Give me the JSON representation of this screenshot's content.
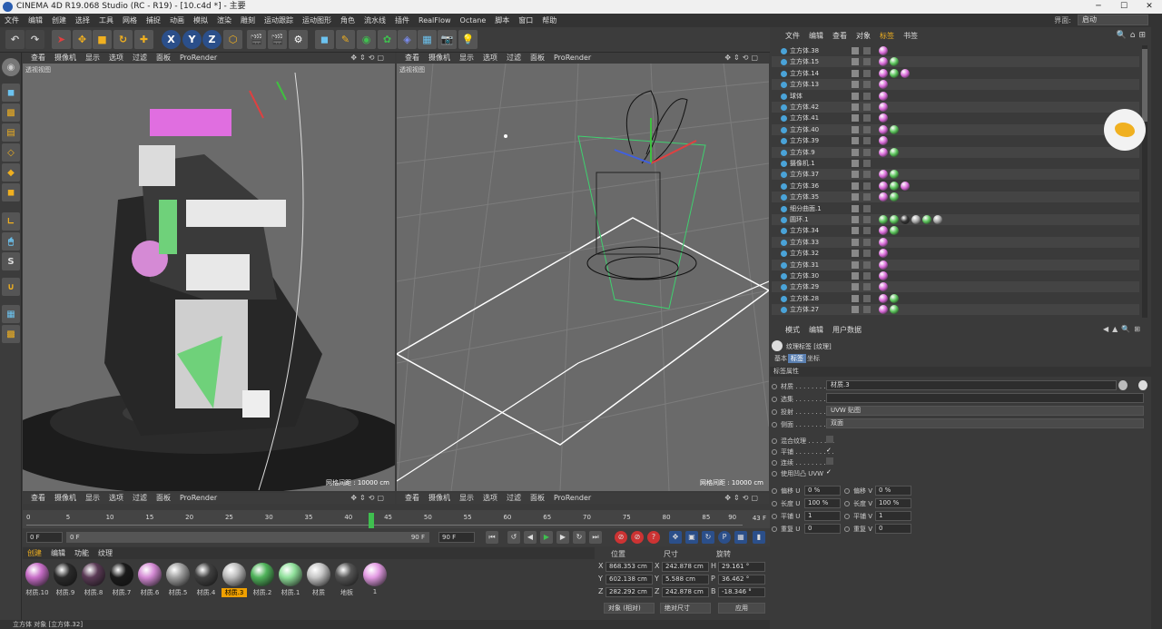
{
  "window": {
    "title": "CINEMA 4D R19.068 Studio (RC - R19) - [10.c4d *] - 主要"
  },
  "menu": [
    "文件",
    "编辑",
    "创建",
    "选择",
    "工具",
    "网格",
    "捕捉",
    "动画",
    "模拟",
    "渲染",
    "雕刻",
    "运动跟踪",
    "运动图形",
    "角色",
    "流水线",
    "插件",
    "RealFlow",
    "Octane",
    "脚本",
    "窗口",
    "帮助"
  ],
  "interface_label": "界面:",
  "interface_value": "启动",
  "toolbar": {
    "x": "X",
    "y": "Y",
    "z": "Z"
  },
  "viewport_menu": [
    "查看",
    "摄像机",
    "显示",
    "选项",
    "过滤",
    "面板",
    "ProRender"
  ],
  "viewport_label": "透视视图",
  "grid_label": "网格间距 : 10000 cm",
  "timeline": {
    "ticks": [
      "0",
      "5",
      "10",
      "15",
      "20",
      "25",
      "30",
      "35",
      "40",
      "45",
      "50",
      "55",
      "60",
      "65",
      "70",
      "75",
      "80",
      "85",
      "90"
    ],
    "current_frame": "43",
    "current_frame_label": "43 F",
    "playhead_fraction": 0.478
  },
  "transport": {
    "start": "0 F",
    "range_start": "0 F",
    "range_end": "90 F",
    "end": "90 F"
  },
  "materials": {
    "tabs": [
      "创建",
      "编辑",
      "功能",
      "纹理"
    ],
    "items": [
      {
        "name": "材质.10",
        "color": "#c86ec8"
      },
      {
        "name": "材质.9",
        "color": "#2a2a2a"
      },
      {
        "name": "材质.8",
        "color": "#5a3a55"
      },
      {
        "name": "材质.7",
        "color": "#1a1a1a"
      },
      {
        "name": "材质.6",
        "color": "#d48ad4"
      },
      {
        "name": "材质.5",
        "color": "#a0a0a0"
      },
      {
        "name": "材质.4",
        "color": "#404040"
      },
      {
        "name": "材质.3",
        "color": "#bdbdbd",
        "selected": true
      },
      {
        "name": "材质.2",
        "color": "#4fb35a"
      },
      {
        "name": "材质.1",
        "color": "#8fe09a"
      },
      {
        "name": "材质",
        "color": "#c6c6c6"
      },
      {
        "name": "地板",
        "color": "#555555"
      },
      {
        "name": "1",
        "color": "#e39be3"
      }
    ]
  },
  "coords": {
    "headers": [
      "位置",
      "尺寸",
      "旋转"
    ],
    "rows": [
      {
        "axis1": "X",
        "pos": "868.353 cm",
        "axis2": "X",
        "size": "242.878 cm",
        "axis3": "H",
        "rot": "29.161 °"
      },
      {
        "axis1": "Y",
        "pos": "602.138 cm",
        "axis2": "Y",
        "size": "5.588 cm",
        "axis3": "P",
        "rot": "36.462 °"
      },
      {
        "axis1": "Z",
        "pos": "282.292 cm",
        "axis2": "Z",
        "size": "242.878 cm",
        "axis3": "B",
        "rot": "-18.346 °"
      }
    ],
    "mode1": "对象 (相对)",
    "mode2": "绝对尺寸",
    "apply": "应用"
  },
  "status": "立方体 对象 [立方体.32]",
  "object_manager": {
    "menu": [
      "文件",
      "编辑",
      "查看",
      "对象",
      "标签",
      "书签"
    ],
    "objects": [
      {
        "name": "立方体.38",
        "tags": [
          "#d86ad8"
        ]
      },
      {
        "name": "立方体.15",
        "tags": [
          "#d86ad8",
          "#5ac35a"
        ]
      },
      {
        "name": "立方体.14",
        "tags": [
          "#d86ad8",
          "#5ac35a",
          "#d86ad8"
        ]
      },
      {
        "name": "立方体.13",
        "tags": [
          "#d86ad8"
        ]
      },
      {
        "name": "球体",
        "tags": [
          "#d86ad8"
        ]
      },
      {
        "name": "立方体.42",
        "tags": [
          "#d86ad8"
        ]
      },
      {
        "name": "立方体.41",
        "tags": [
          "#d86ad8"
        ]
      },
      {
        "name": "立方体.40",
        "tags": [
          "#d86ad8",
          "#5ac35a"
        ]
      },
      {
        "name": "立方体.39",
        "tags": [
          "#d86ad8"
        ]
      },
      {
        "name": "立方体.9",
        "tags": [
          "#d86ad8",
          "#5ac35a"
        ]
      },
      {
        "name": "摄像机.1",
        "tags": []
      },
      {
        "name": "立方体.37",
        "tags": [
          "#d86ad8",
          "#5ac35a"
        ]
      },
      {
        "name": "立方体.36",
        "tags": [
          "#d86ad8",
          "#5ac35a",
          "#d86ad8"
        ]
      },
      {
        "name": "立方体.35",
        "tags": [
          "#d86ad8",
          "#5ac35a"
        ]
      },
      {
        "name": "细分曲面.1",
        "tags": []
      },
      {
        "name": "圆环.1",
        "tags": [
          "#5ac35a",
          "#5ac35a",
          "#333333",
          "#aaaaaa",
          "#5ac35a",
          "#aaaaaa"
        ]
      },
      {
        "name": "立方体.34",
        "tags": [
          "#d86ad8",
          "#5ac35a"
        ]
      },
      {
        "name": "立方体.33",
        "tags": [
          "#d86ad8"
        ]
      },
      {
        "name": "立方体.32",
        "tags": [
          "#d86ad8"
        ]
      },
      {
        "name": "立方体.31",
        "tags": [
          "#d86ad8"
        ]
      },
      {
        "name": "立方体.30",
        "tags": [
          "#d86ad8"
        ]
      },
      {
        "name": "立方体.29",
        "tags": [
          "#d86ad8"
        ]
      },
      {
        "name": "立方体.28",
        "tags": [
          "#d86ad8",
          "#5ac35a"
        ]
      },
      {
        "name": "立方体.27",
        "tags": [
          "#d86ad8",
          "#5ac35a"
        ]
      }
    ]
  },
  "attributes": {
    "menu": [
      "模式",
      "编辑",
      "用户数据"
    ],
    "title": "纹理标签 [纹理]",
    "tabs": [
      "基本",
      "标签",
      "坐标"
    ],
    "section": "标签属性",
    "material_label": "材质 . . . . . . . . . .",
    "material_value": "材质.3",
    "selection_label": "选集 . . . . . . . . . .",
    "projection_label": "投射 . . . . . . . . . .",
    "projection_value": "UVW 贴图",
    "side_label": "侧面 . . . . . . . . . .",
    "side_value": "双面",
    "mix_label": "混合纹理 . . . . . . .",
    "tile_label": "平铺 . . . . . . . . . .",
    "tile_check": "✓",
    "seamless_label": "连续 . . . . . . . . . .",
    "uvw_bump_label": "使用凹凸 UVW",
    "uvw_bump_check": "✓",
    "offset_u": "偏移 U",
    "offset_u_val": "0 %",
    "offset_v": "偏移 V",
    "offset_v_val": "0 %",
    "length_u": "长度 U",
    "length_u_val": "100 %",
    "length_v": "长度 V",
    "length_v_val": "100 %",
    "tiles_u": "平铺 U",
    "tiles_u_val": "1",
    "tiles_v": "平铺 V",
    "tiles_v_val": "1",
    "repeat_u": "重复 U",
    "repeat_u_val": "0",
    "repeat_v": "重复 V",
    "repeat_v_val": "0"
  }
}
